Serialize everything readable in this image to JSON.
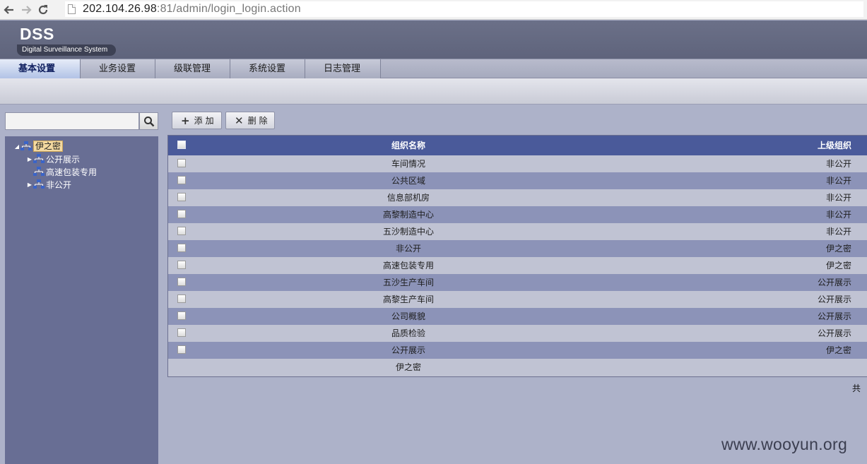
{
  "browser": {
    "back_icon": "arrow-left-icon",
    "forward_icon": "arrow-right-icon",
    "reload_icon": "reload-icon",
    "url_host": "202.104.26.98",
    "url_rest": ":81/admin/login_login.action"
  },
  "app": {
    "logo": "DSS",
    "subtitle": "Digital Surveillance System"
  },
  "tabs": [
    {
      "label": "基本设置",
      "active": true
    },
    {
      "label": "业务设置",
      "active": false
    },
    {
      "label": "级联管理",
      "active": false
    },
    {
      "label": "系统设置",
      "active": false
    },
    {
      "label": "日志管理",
      "active": false
    }
  ],
  "search": {
    "value": "",
    "icon": "search-icon"
  },
  "tree": {
    "root": "伊之密",
    "children": [
      {
        "label": "公开展示",
        "expandable": true
      },
      {
        "label": "高速包装专用",
        "expandable": false
      },
      {
        "label": "非公开",
        "expandable": true
      }
    ]
  },
  "toolbar": {
    "add_label": "添加",
    "delete_label": "删除"
  },
  "grid": {
    "columns": {
      "name": "组织名称",
      "parent": "上级组织"
    },
    "rows": [
      {
        "name": "车间情况",
        "parent": "非公开"
      },
      {
        "name": "公共区域",
        "parent": "非公开"
      },
      {
        "name": "信息部机房",
        "parent": "非公开"
      },
      {
        "name": "高黎制造中心",
        "parent": "非公开"
      },
      {
        "name": "五沙制造中心",
        "parent": "非公开"
      },
      {
        "name": "非公开",
        "parent": "伊之密"
      },
      {
        "name": "高速包装专用",
        "parent": "伊之密"
      },
      {
        "name": "五沙生产车间",
        "parent": "公开展示"
      },
      {
        "name": "高黎生产车间",
        "parent": "公开展示"
      },
      {
        "name": "公司概貌",
        "parent": "公开展示"
      },
      {
        "name": "品质检验",
        "parent": "公开展示"
      },
      {
        "name": "公开展示",
        "parent": "伊之密"
      },
      {
        "name": "伊之密",
        "parent": ""
      }
    ]
  },
  "footer": {
    "total_label": "共"
  },
  "watermark": "www.wooyun.org",
  "colors": {
    "header": "#636880",
    "grid_header": "#4a5a9a",
    "row_alt": "#8c93b8",
    "tree_panel": "#686e94"
  }
}
